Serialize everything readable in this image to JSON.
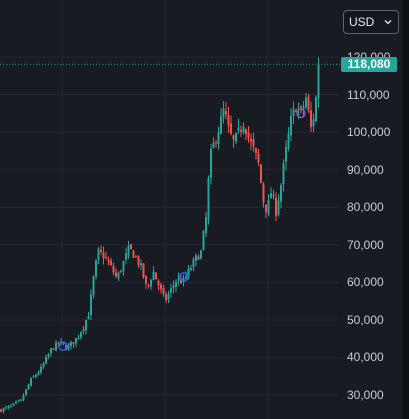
{
  "currency_selector": {
    "selected": "USD",
    "icon": "chevron-down-icon"
  },
  "last_price_label": "118,080",
  "colors": {
    "background": "#181b22",
    "grid": "#232733",
    "up": "#26a69a",
    "down": "#ef5350",
    "marker": "#2962ff",
    "marker_alt": "#7e57c2"
  },
  "chart_data": {
    "type": "candlestick",
    "ylim": [
      25000,
      125000
    ],
    "y_ticks": [
      {
        "value": 120000,
        "label": "120,000"
      },
      {
        "value": 110000,
        "label": "110,000"
      },
      {
        "value": 100000,
        "label": "100,000"
      },
      {
        "value": 90000,
        "label": "90,000"
      },
      {
        "value": 80000,
        "label": "80,000"
      },
      {
        "value": 70000,
        "label": "70,000"
      },
      {
        "value": 60000,
        "label": "60,000"
      },
      {
        "value": 50000,
        "label": "50,000"
      },
      {
        "value": 40000,
        "label": "40,000"
      },
      {
        "value": 30000,
        "label": "30,000"
      }
    ],
    "last_price": 118080,
    "close_path": [
      [
        0,
        26000
      ],
      [
        10,
        27000
      ],
      [
        20,
        28500
      ],
      [
        30,
        34000
      ],
      [
        40,
        37000
      ],
      [
        50,
        42000
      ],
      [
        58,
        44000
      ],
      [
        66,
        42500
      ],
      [
        74,
        44500
      ],
      [
        82,
        48000
      ],
      [
        88,
        52000
      ],
      [
        93,
        62000
      ],
      [
        97,
        68000
      ],
      [
        103,
        67000
      ],
      [
        110,
        64000
      ],
      [
        116,
        61000
      ],
      [
        122,
        65000
      ],
      [
        128,
        69000
      ],
      [
        134,
        67000
      ],
      [
        140,
        64000
      ],
      [
        146,
        58000
      ],
      [
        152,
        63000
      ],
      [
        158,
        59000
      ],
      [
        164,
        55000
      ],
      [
        170,
        58000
      ],
      [
        176,
        61000
      ],
      [
        182,
        60000
      ],
      [
        188,
        63000
      ],
      [
        194,
        66000
      ],
      [
        200,
        68000
      ],
      [
        205,
        77000
      ],
      [
        209,
        93000
      ],
      [
        214,
        98000
      ],
      [
        219,
        102000
      ],
      [
        223,
        106000
      ],
      [
        228,
        100000
      ],
      [
        233,
        97000
      ],
      [
        238,
        100000
      ],
      [
        243,
        103000
      ],
      [
        248,
        98000
      ],
      [
        253,
        95000
      ],
      [
        258,
        91000
      ],
      [
        262,
        82000
      ],
      [
        266,
        79000
      ],
      [
        270,
        84000
      ],
      [
        275,
        79000
      ],
      [
        280,
        86000
      ],
      [
        285,
        95000
      ],
      [
        290,
        103000
      ],
      [
        295,
        107000
      ],
      [
        300,
        105000
      ],
      [
        305,
        109000
      ],
      [
        310,
        101000
      ],
      [
        314,
        106000
      ],
      [
        318,
        118000
      ]
    ],
    "markers": [
      {
        "x": 63,
        "price": 43000,
        "color": "marker"
      },
      {
        "x": 184,
        "price": 61500,
        "color": "marker"
      },
      {
        "x": 301,
        "price": 105000,
        "color": "marker_alt"
      }
    ]
  }
}
